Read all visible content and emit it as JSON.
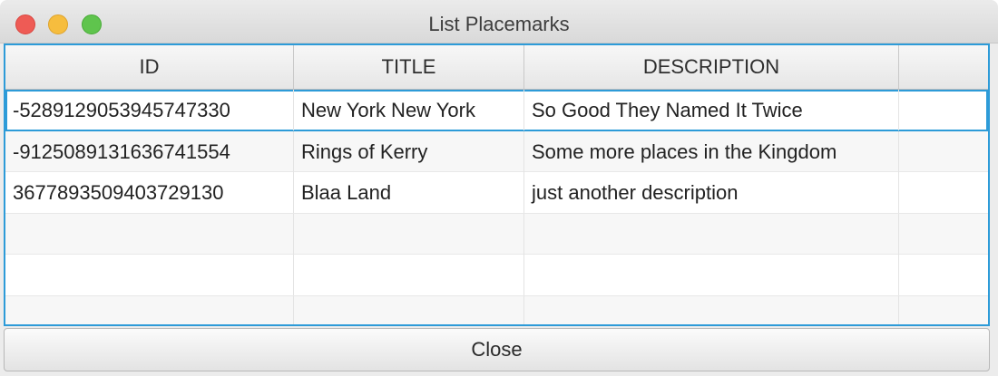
{
  "window": {
    "title": "List Placemarks"
  },
  "table": {
    "columns": [
      "ID",
      "TITLE",
      "DESCRIPTION",
      ""
    ],
    "rows": [
      {
        "id": "-5289129053945747330",
        "title": "New York New York",
        "description": "So Good They Named It Twice",
        "selected": true
      },
      {
        "id": "-9125089131636741554",
        "title": "Rings of Kerry",
        "description": "Some more places in the Kingdom",
        "selected": false
      },
      {
        "id": "3677893509403729130",
        "title": "Blaa Land",
        "description": "just another description",
        "selected": false
      },
      {
        "id": "",
        "title": "",
        "description": "",
        "selected": false
      },
      {
        "id": "",
        "title": "",
        "description": "",
        "selected": false
      },
      {
        "id": "",
        "title": "",
        "description": "",
        "selected": false
      }
    ]
  },
  "footer": {
    "close_label": "Close"
  },
  "colors": {
    "accent": "#2d9bd8",
    "traffic_close": "#ee5b55",
    "traffic_minimize": "#f6bd3e",
    "traffic_maximize": "#5fc44d"
  }
}
